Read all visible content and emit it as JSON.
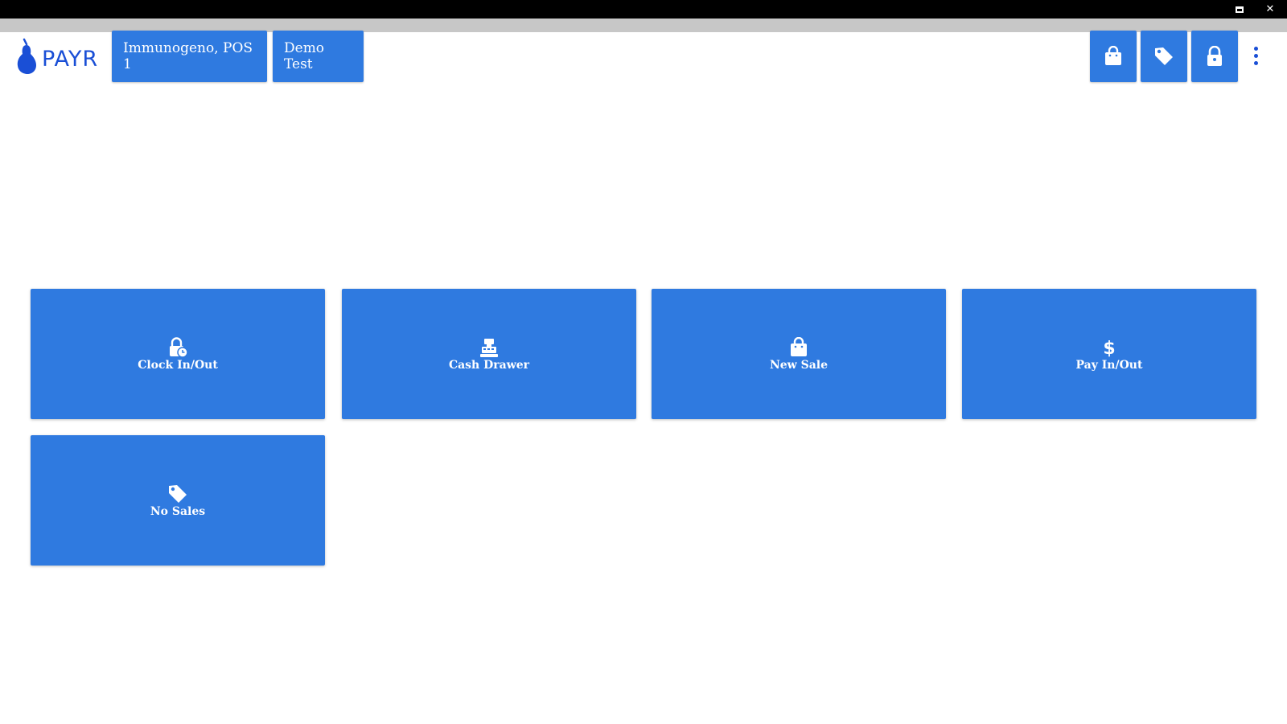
{
  "window": {
    "restore_label": "",
    "close_label": "✕"
  },
  "brand": {
    "logo_text": "PAYR",
    "color": "#1a4fd6"
  },
  "header": {
    "store_label": "Immunogeno, POS 1",
    "user_label": "Demo Test",
    "icon_buttons": [
      {
        "icon": "shopping-bag-icon"
      },
      {
        "icon": "tag-icon"
      },
      {
        "icon": "lock-icon"
      }
    ],
    "menu_icon": "more-vertical-icon"
  },
  "tiles": [
    {
      "label": "Clock In/Out",
      "icon": "clock-lock-icon"
    },
    {
      "label": "Cash Drawer",
      "icon": "cash-register-icon"
    },
    {
      "label": "New Sale",
      "icon": "shopping-bag-icon"
    },
    {
      "label": "Pay In/Out",
      "icon": "dollar-icon",
      "glyph": "$"
    },
    {
      "label": "No Sales",
      "icon": "tag-icon"
    }
  ],
  "colors": {
    "accent": "#2f7ae0",
    "titlebar": "#000000",
    "greybar": "#c7c7c7"
  }
}
